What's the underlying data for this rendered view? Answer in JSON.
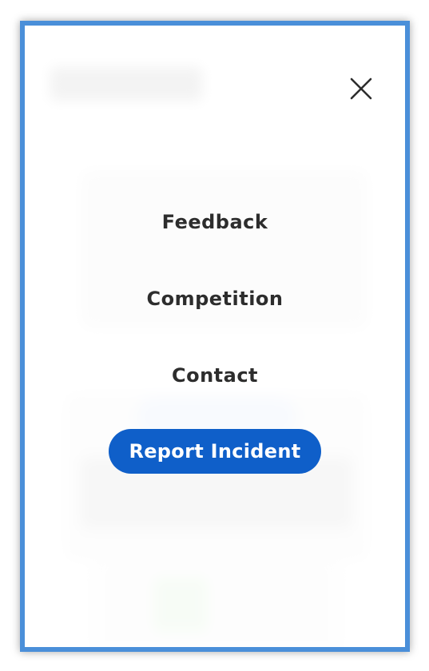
{
  "menu": {
    "items": [
      {
        "label": "Feedback"
      },
      {
        "label": "Competition"
      },
      {
        "label": "Contact"
      }
    ],
    "cta_label": "Report Incident"
  },
  "icons": {
    "close": "close-icon"
  },
  "colors": {
    "frame_border": "#4a8fd9",
    "cta_background": "#0f5fc9",
    "text": "#2d2d2d"
  }
}
